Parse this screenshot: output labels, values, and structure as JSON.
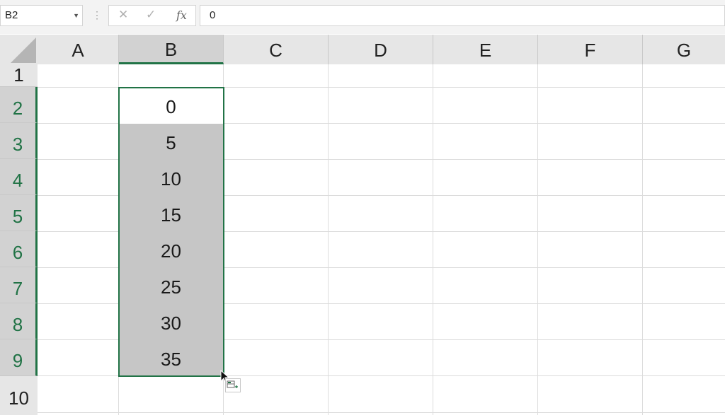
{
  "formula_bar": {
    "name_box": "B2",
    "cancel_glyph": "✕",
    "enter_glyph": "✓",
    "fx_label": "fx",
    "formula_value": "0"
  },
  "columns": [
    "A",
    "B",
    "C",
    "D",
    "E",
    "F",
    "G"
  ],
  "rows": [
    "1",
    "2",
    "3",
    "4",
    "5",
    "6",
    "7",
    "8",
    "9",
    "10"
  ],
  "cells_B": [
    "0",
    "5",
    "10",
    "15",
    "20",
    "25",
    "30",
    "35"
  ],
  "selection": {
    "active_cell": "B2",
    "range": "B2:B9"
  },
  "colors": {
    "accent": "#217346",
    "selected_fill": "#c6c6c6",
    "header_bg": "#e6e6e6"
  },
  "icons": [
    "select-all-triangle-icon",
    "cancel-icon",
    "enter-icon",
    "fx-icon",
    "mouse-pointer-icon",
    "quick-analysis-icon"
  ]
}
